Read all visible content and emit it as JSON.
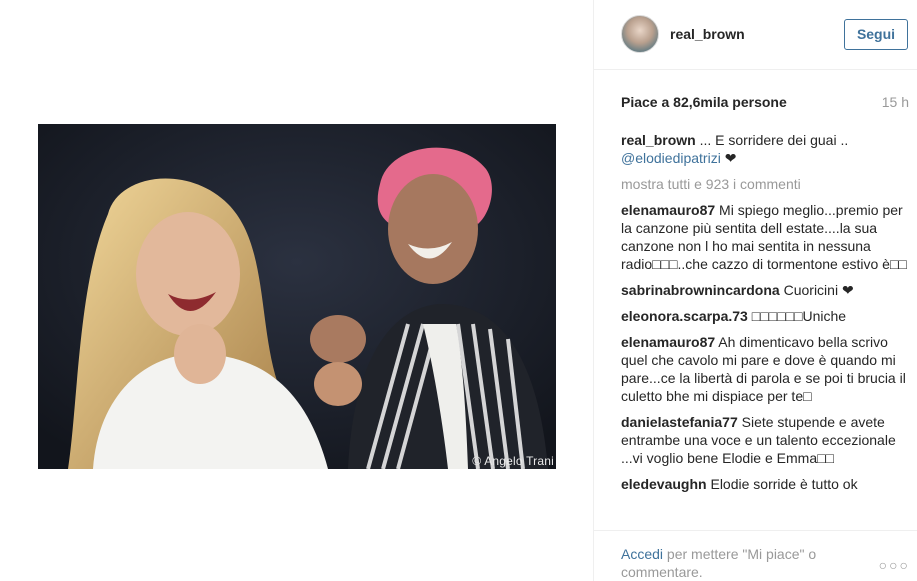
{
  "post": {
    "photo_credit": "© Angelo Trani",
    "username": "real_brown",
    "follow_label": "Segui",
    "likes": "Piace a 82,6mila persone",
    "time": "15 h",
    "caption": {
      "user": "real_brown",
      "text": " ... E sorridere dei guai ..",
      "mention": "@elodiedipatrizi",
      "heart": " ❤"
    },
    "load_more": "mostra tutti e 923 i commenti",
    "comments": [
      {
        "user": "elenamauro87",
        "text": " Mi spiego meglio...premio per la canzone più sentita dell estate....la sua canzone non l ho mai sentita in nessuna radio□□□..che cazzo di tormentone estivo è□□"
      },
      {
        "user": "sabrinabrownincardona",
        "text": " Cuoricini ❤"
      },
      {
        "user": "eleonora.scarpa.73",
        "text": " □□□□□□Uniche"
      },
      {
        "user": "elenamauro87",
        "text": " Ah dimenticavo bella scrivo quel che cavolo mi pare e dove è quando mi pare...ce la libertà di parola e se poi ti brucia il culetto bhe mi dispiace per te□"
      },
      {
        "user": "danielastefania77",
        "text": " Siete stupende e avete entrambe una voce e un talento eccezionale ...vi voglio bene Elodie e Emma□□"
      },
      {
        "user": "eledevaughn",
        "text": " Elodie sorride è tutto ok"
      }
    ],
    "login": {
      "link": "Accedi",
      "text": " per mettere \"Mi piace\" o commentare."
    },
    "more_label": "○○○"
  }
}
